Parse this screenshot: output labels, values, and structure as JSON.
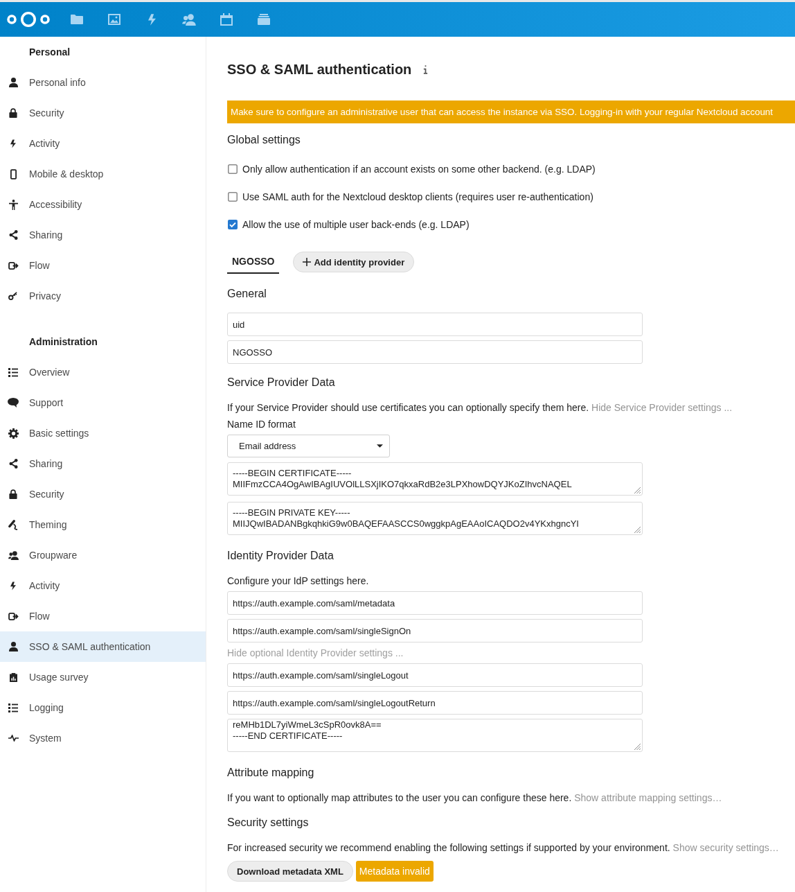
{
  "sidebar": {
    "sections": [
      {
        "title": "Personal",
        "items": [
          {
            "label": "Personal info",
            "selected": false
          },
          {
            "label": "Security",
            "selected": false
          },
          {
            "label": "Activity",
            "selected": false
          },
          {
            "label": "Mobile & desktop",
            "selected": false
          },
          {
            "label": "Accessibility",
            "selected": false
          },
          {
            "label": "Sharing",
            "selected": false
          },
          {
            "label": "Flow",
            "selected": false
          },
          {
            "label": "Privacy",
            "selected": false
          }
        ]
      },
      {
        "title": "Administration",
        "items": [
          {
            "label": "Overview",
            "selected": false
          },
          {
            "label": "Support",
            "selected": false
          },
          {
            "label": "Basic settings",
            "selected": false
          },
          {
            "label": "Sharing",
            "selected": false
          },
          {
            "label": "Security",
            "selected": false
          },
          {
            "label": "Theming",
            "selected": false
          },
          {
            "label": "Groupware",
            "selected": false
          },
          {
            "label": "Activity",
            "selected": false
          },
          {
            "label": "Flow",
            "selected": false
          },
          {
            "label": "SSO & SAML authentication",
            "selected": true
          },
          {
            "label": "Usage survey",
            "selected": false
          },
          {
            "label": "Logging",
            "selected": false
          },
          {
            "label": "System",
            "selected": false
          }
        ]
      }
    ]
  },
  "page": {
    "title": "SSO & SAML authentication",
    "warning": "Make sure to configure an administrative user that can access the instance via SSO. Logging-in with your regular Nextcloud account"
  },
  "global_settings": {
    "heading": "Global settings",
    "options": [
      {
        "label": "Only allow authentication if an account exists on some other backend. (e.g. LDAP)",
        "checked": false
      },
      {
        "label": "Use SAML auth for the Nextcloud desktop clients (requires user re-authentication)",
        "checked": false
      },
      {
        "label": "Allow the use of multiple user back-ends (e.g. LDAP)",
        "checked": true
      }
    ]
  },
  "providers": {
    "tabs": [
      {
        "label": "NGOSSO",
        "selected": true
      }
    ],
    "add_button": "Add identity provider"
  },
  "general": {
    "heading": "General",
    "fields": [
      "uid",
      "NGOSSO"
    ]
  },
  "service_provider": {
    "heading": "Service Provider Data",
    "description": "If your Service Provider should use certificates you can optionally specify them here.",
    "toggle_link": "Hide Service Provider settings ...",
    "name_id_label": "Name ID format",
    "name_id_format": "Email address",
    "certificate": "-----BEGIN CERTIFICATE-----\nMIIFmzCCA4OgAwIBAgIUVOlLLSXjIKO7qkxaRdB2e3LPXhowDQYJKoZIhvcNAQEL",
    "private_key": "-----BEGIN PRIVATE KEY-----\nMIIJQwIBADANBgkqhkiG9w0BAQEFAASCCS0wggkpAgEAAoICAQDO2v4YKxhgncYI"
  },
  "identity_provider": {
    "heading": "Identity Provider Data",
    "description": "Configure your IdP settings here.",
    "fields": [
      "https://auth.example.com/saml/metadata",
      "https://auth.example.com/saml/singleSignOn"
    ],
    "optional_link": "Hide optional Identity Provider settings ...",
    "optional_fields": [
      "https://auth.example.com/saml/singleLogout",
      "https://auth.example.com/saml/singleLogoutReturn"
    ],
    "certificate": "reMHb1DL7yiWmeL3cSpR0ovk8A==\n-----END CERTIFICATE-----"
  },
  "attribute_mapping": {
    "heading": "Attribute mapping",
    "description": "If you want to optionally map attributes to the user you can configure these here.",
    "toggle_link": "Show attribute mapping settings…"
  },
  "security_settings": {
    "heading": "Security settings",
    "description": "For increased security we recommend enabling the following settings if supported by your environment.",
    "toggle_link": "Show security settings…"
  },
  "actions": {
    "download_button": "Download metadata XML",
    "status": "Metadata invalid"
  }
}
